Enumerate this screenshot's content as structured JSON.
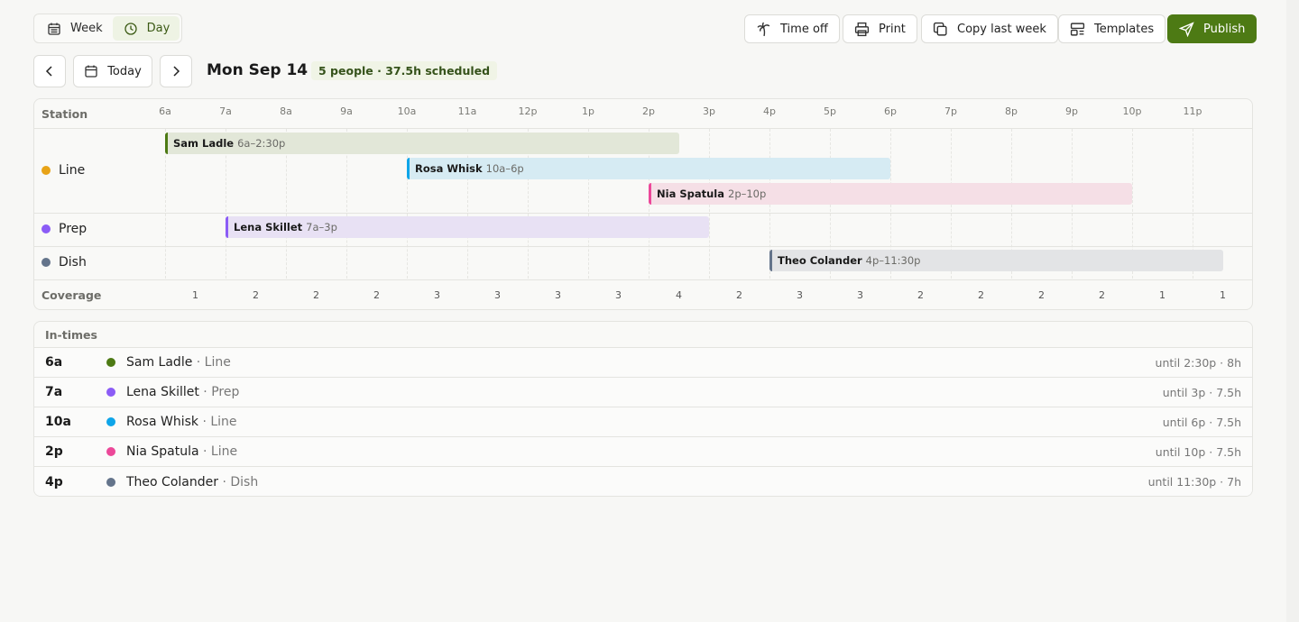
{
  "view_toggle": {
    "week": "Week",
    "day": "Day",
    "active": "day"
  },
  "toolbar": {
    "time_off": "Time off",
    "print": "Print",
    "copy_last_week": "Copy last week",
    "templates": "Templates",
    "publish": "Publish"
  },
  "nav": {
    "today": "Today",
    "date": "Mon Sep 14",
    "summary": "5 people · 37.5h scheduled"
  },
  "colors": {
    "accent": "#4d7a14",
    "line": "#e8a317",
    "prep": "#8b5cf6",
    "dish": "#64748b"
  },
  "schedule": {
    "station_header": "Station",
    "coverage_label": "Coverage",
    "hours": [
      "6a",
      "7a",
      "8a",
      "9a",
      "10a",
      "11a",
      "12p",
      "1p",
      "2p",
      "3p",
      "4p",
      "5p",
      "6p",
      "7p",
      "8p",
      "9p",
      "10p",
      "11p"
    ],
    "stations": [
      {
        "name": "Line",
        "color": "#e8a317",
        "shifts": [
          {
            "name": "Sam Ladle",
            "time": "6a–2:30p",
            "start": 6,
            "end": 14.5,
            "color": "#4d7a14",
            "bg": "#e2e7d8"
          },
          {
            "name": "Rosa Whisk",
            "time": "10a–6p",
            "start": 10,
            "end": 18,
            "color": "#0ea5e9",
            "bg": "#d6ebf3"
          },
          {
            "name": "Nia Spatula",
            "time": "2p–10p",
            "start": 14,
            "end": 22,
            "color": "#ec4899",
            "bg": "#f5dfe6"
          }
        ]
      },
      {
        "name": "Prep",
        "color": "#8b5cf6",
        "shifts": [
          {
            "name": "Lena Skillet",
            "time": "7a–3p",
            "start": 7,
            "end": 15,
            "color": "#8b5cf6",
            "bg": "#e8e1f4"
          }
        ]
      },
      {
        "name": "Dish",
        "color": "#64748b",
        "shifts": [
          {
            "name": "Theo Colander",
            "time": "4p–11:30p",
            "start": 16,
            "end": 23.5,
            "color": "#64748b",
            "bg": "#e3e4e6"
          }
        ]
      }
    ],
    "coverage": [
      1,
      2,
      2,
      2,
      3,
      3,
      3,
      3,
      4,
      2,
      3,
      3,
      2,
      2,
      2,
      2,
      1,
      1
    ]
  },
  "intimes": {
    "title": "In-times",
    "rows": [
      {
        "time": "6a",
        "name": "Sam Ladle",
        "station": "· Line",
        "until": "until 2:30p · 8h",
        "color": "#4d7a14"
      },
      {
        "time": "7a",
        "name": "Lena Skillet",
        "station": "· Prep",
        "until": "until 3p · 7.5h",
        "color": "#8b5cf6"
      },
      {
        "time": "10a",
        "name": "Rosa Whisk",
        "station": "· Line",
        "until": "until 6p · 7.5h",
        "color": "#0ea5e9"
      },
      {
        "time": "2p",
        "name": "Nia Spatula",
        "station": "· Line",
        "until": "until 10p · 7.5h",
        "color": "#ec4899"
      },
      {
        "time": "4p",
        "name": "Theo Colander",
        "station": "· Dish",
        "until": "until 11:30p · 7h",
        "color": "#64748b"
      }
    ]
  }
}
